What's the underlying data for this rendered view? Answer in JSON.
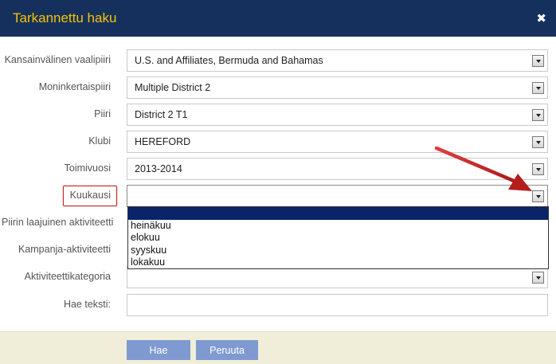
{
  "dialog": {
    "title": "Tarkannettu haku",
    "close_icon": "close-icon"
  },
  "fields": {
    "international_constituency": {
      "label": "Kansainvälinen vaalipiiri",
      "value": "U.S. and Affiliates, Bermuda and Bahamas"
    },
    "multiple_district": {
      "label": "Moninkertaispiiri",
      "value": "Multiple District 2"
    },
    "district": {
      "label": "Piiri",
      "value": "District 2 T1"
    },
    "club": {
      "label": "Klubi",
      "value": "HEREFORD"
    },
    "fiscal_year": {
      "label": "Toimivuosi",
      "value": "2013-2014"
    },
    "month": {
      "label": "Kuukausi",
      "value": "",
      "options": [
        "",
        "heinäkuu",
        "elokuu",
        "syyskuu",
        "lokakuu"
      ]
    },
    "district_wide_activity": {
      "label": "Piirin laajuinen aktiviteetti"
    },
    "campaign_activity": {
      "label": "Kampanja-aktiviteetti"
    },
    "activity_category": {
      "label": "Aktiviteettikategoria"
    },
    "search_text": {
      "label": "Hae teksti:",
      "value": ""
    }
  },
  "footer": {
    "search_label": "Hae",
    "cancel_label": "Peruuta"
  },
  "colors": {
    "titlebar": "#16305e",
    "title_text": "#f5c400",
    "button": "#7f9ad0",
    "footer": "#f0edd9",
    "annotation": "#c0262a",
    "selected_option": "#0a246a"
  }
}
